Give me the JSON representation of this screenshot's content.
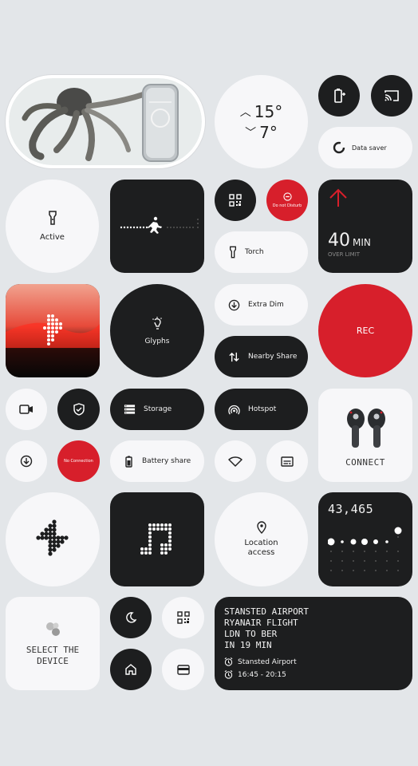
{
  "weather": {
    "high": "15°",
    "low": "7°"
  },
  "data_saver": {
    "label": "Data saver"
  },
  "flashlight": {
    "label": "Active"
  },
  "dnd": {
    "label": "Do not Disturb"
  },
  "torch": {
    "label": "Torch"
  },
  "screen_time": {
    "value": "40",
    "unit": "MIN",
    "sub": "OVER LIMIT"
  },
  "extra_dim": {
    "label": "Extra Dim"
  },
  "nearby_share": {
    "label": "Nearby Share"
  },
  "glyphs": {
    "label": "Glyphs"
  },
  "recorder": {
    "label": "REC"
  },
  "storage": {
    "label": "Storage"
  },
  "hotspot": {
    "label": "Hotspot"
  },
  "connect": {
    "label": "CONNECT"
  },
  "no_connection": {
    "label": "No Connection"
  },
  "battery_share": {
    "label": "Battery share"
  },
  "location": {
    "label": "Location access"
  },
  "steps": {
    "value": "43,465"
  },
  "device_select": {
    "label": "SELECT THE DEVICE"
  },
  "flight": {
    "line1": "STANSTED AIRPORT",
    "line2": "RYANAIR FLIGHT",
    "line3": "LDN TO BER",
    "line4": "IN 19 MIN",
    "place": "Stansted Airport",
    "time": "16:45 - 20:15"
  },
  "colors": {
    "accent": "#d71f2b",
    "dark": "#1d1e1f",
    "light": "#f7f7f9",
    "background": "#e3e6e9"
  }
}
